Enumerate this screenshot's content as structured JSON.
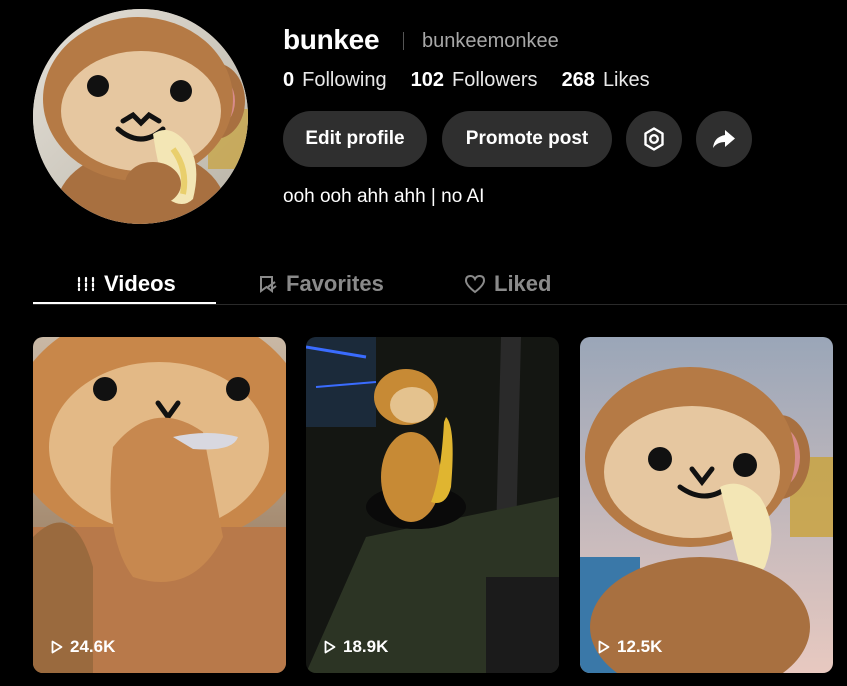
{
  "profile": {
    "username": "bunkee",
    "handle": "bunkeemonkee",
    "bio": "ooh ooh ahh ahh | no AI",
    "stats": [
      {
        "value": "0",
        "label": "Following"
      },
      {
        "value": "102",
        "label": "Followers"
      },
      {
        "value": "268",
        "label": "Likes"
      }
    ]
  },
  "actions": {
    "edit_label": "Edit profile",
    "promote_label": "Promote post",
    "settings_icon": "gear-icon",
    "share_icon": "share-arrow-icon"
  },
  "tabs": [
    {
      "label": "Videos",
      "icon": "grid-icon",
      "active": true
    },
    {
      "label": "Favorites",
      "icon": "bookmark-icon",
      "active": false
    },
    {
      "label": "Liked",
      "icon": "heart-icon",
      "active": false
    }
  ],
  "videos": [
    {
      "views": "24.6K"
    },
    {
      "views": "18.9K"
    },
    {
      "views": "12.5K"
    }
  ],
  "colors": {
    "background": "#000000",
    "button_bg": "#2f2f2f",
    "muted_text": "#a8a8a8",
    "monkey_brown": "#b07a45"
  }
}
